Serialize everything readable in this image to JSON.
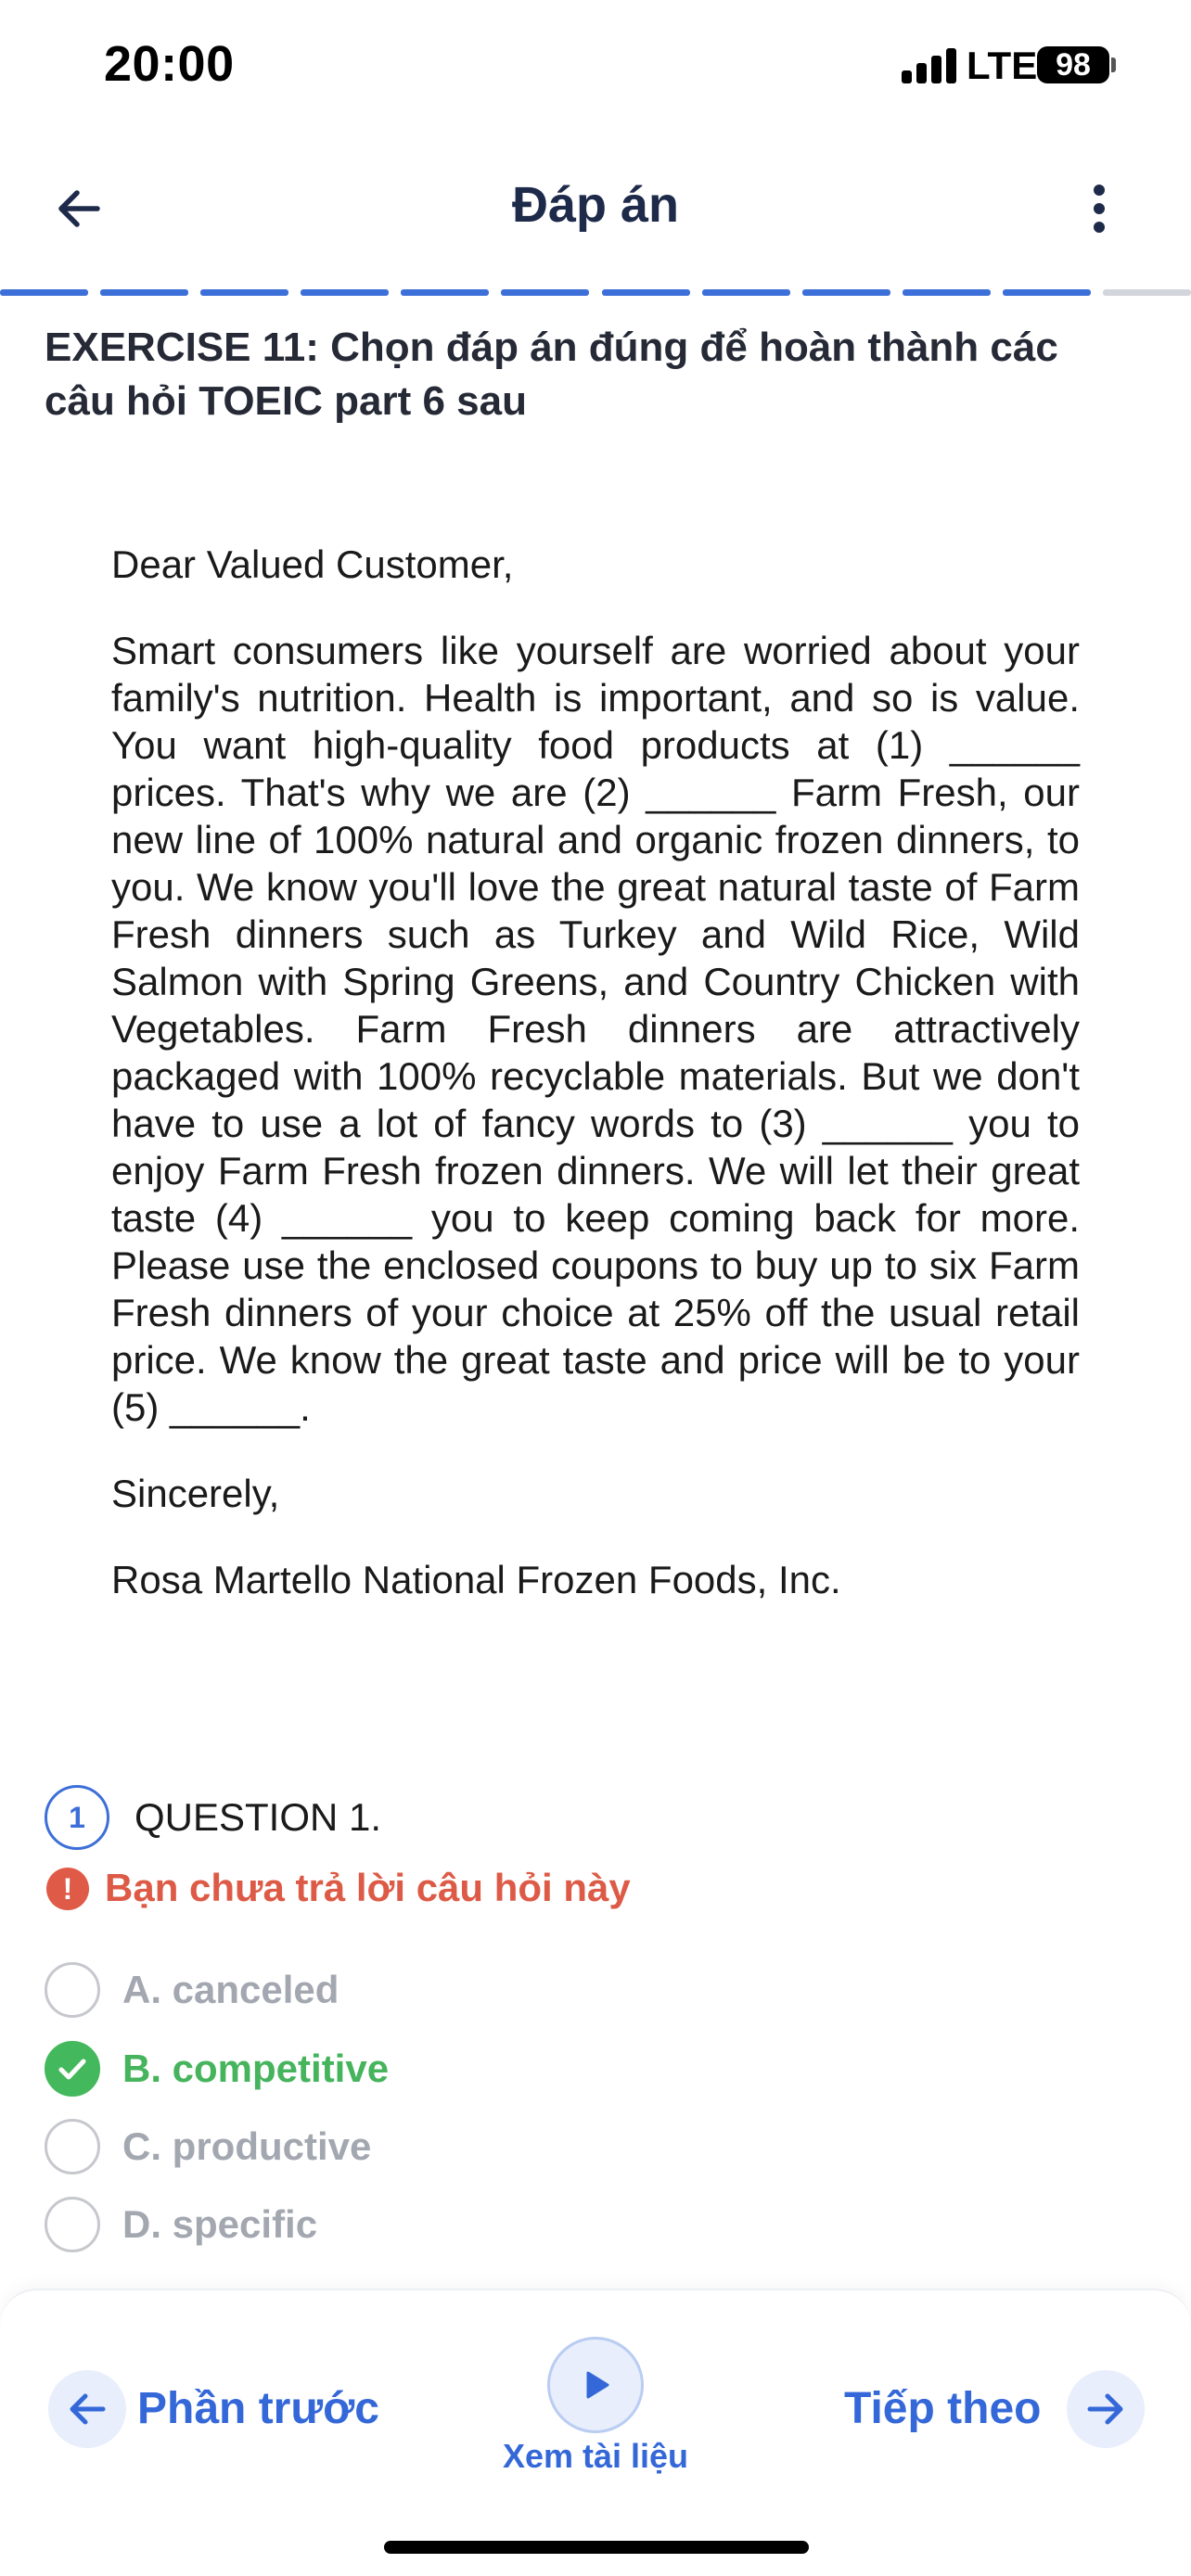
{
  "status_bar": {
    "time": "20:00",
    "network": "LTE",
    "battery": "98"
  },
  "header": {
    "title": "Đáp án",
    "back_icon": "arrow-left-icon",
    "more_icon": "vertical-dots-icon"
  },
  "progress": {
    "segments_total": 12,
    "segments_done": 11,
    "accent": "#3d6fd8"
  },
  "exercise": {
    "title": "EXERCISE 11: Chọn đáp án đúng để hoàn thành các câu hỏi TOEIC part 6 sau"
  },
  "passage": {
    "greeting": "Dear Valued Customer,",
    "body": "Smart consumers like yourself are worried about your family's nutrition. Health is important, and so is value. You want high-quality food products at (1) ______ prices. That's why we are (2) ______ Farm Fresh, our new line of 100% natural and organic frozen dinners, to you. We know you'll love the great natural taste of Farm Fresh dinners such as Turkey and Wild Rice, Wild Salmon with Spring Greens, and Country Chicken with Vegetables. Farm Fresh dinners are attractively packaged with 100% recyclable materials. But we don't have to use a lot of fancy words to (3) ______ you to enjoy Farm Fresh frozen dinners. We will let their great taste (4) ______ you to keep coming back for more. Please use the enclosed coupons to buy up to six Farm Fresh dinners of your choice at 25% off the usual retail price. We know the great taste and price will be to your (5) ______.",
    "closing": "Sincerely,",
    "signature": "Rosa Martello National Frozen Foods, Inc."
  },
  "question": {
    "number": "1",
    "title": "QUESTION 1.",
    "warning": "Bạn chưa trả lời câu hỏi này",
    "options": [
      {
        "label": "A. canceled",
        "state": "neutral"
      },
      {
        "label": "B. competitive",
        "state": "correct"
      },
      {
        "label": "C. productive",
        "state": "neutral"
      },
      {
        "label": "D. specific",
        "state": "neutral"
      }
    ]
  },
  "bottom_bar": {
    "prev_label": "Phần trước",
    "next_label": "Tiếp theo",
    "materials_label": "Xem tài liệu"
  },
  "colors": {
    "correct": "#46b45c",
    "warning": "#dd5b46",
    "primary": "#3468d8"
  }
}
